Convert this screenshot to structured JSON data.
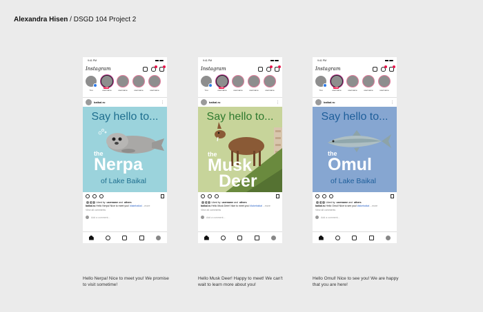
{
  "header": {
    "name": "Alexandra Hisen",
    "separator": " / ",
    "project": "DSGD 104 Project 2"
  },
  "colors": {
    "instagram_badge": "#e8174c",
    "story_ring": "#e07a9a",
    "hashtag": "#2a63c7"
  },
  "phones": [
    {
      "status": {
        "time": "9:41 PM"
      },
      "app": {
        "logo": "Instagram"
      },
      "stories": [
        {
          "label": "You"
        },
        {
          "label": "username",
          "live": "LIVE"
        },
        {
          "label": "username"
        },
        {
          "label": "username"
        },
        {
          "label": "username"
        }
      ],
      "post": {
        "username": "baikal.ru",
        "more": "⋮",
        "image": {
          "title": "Say hello to...",
          "the": "the",
          "name_line1": "Nerpa",
          "name_line2": "",
          "subtitle": "of Lake Baikal"
        },
        "liked": {
          "prefix": "Liked by",
          "user": "username",
          "and": "and",
          "others": "others"
        },
        "caption": {
          "user": "baikal.ru",
          "text": " Hello Nerpa! Nice to meet you! ",
          "tag": "#lakebaikal",
          "more": " ...more"
        },
        "view_all": "View all comments",
        "add_comment": "Add a comment..."
      },
      "below": "Hello Nerpa! Nice to meet you! We promise to visit sometime!"
    },
    {
      "status": {
        "time": "9:41 PM"
      },
      "app": {
        "logo": "Instagram"
      },
      "stories": [
        {
          "label": "You"
        },
        {
          "label": "username",
          "live": "LIVE"
        },
        {
          "label": "username"
        },
        {
          "label": "username"
        },
        {
          "label": "username"
        }
      ],
      "post": {
        "username": "baikal.ru",
        "more": "⋮",
        "image": {
          "title": "Say hello to...",
          "the": "the",
          "name_line1": "Musk",
          "name_line2": "Deer",
          "subtitle": ""
        },
        "liked": {
          "prefix": "Liked by",
          "user": "username",
          "and": "and",
          "others": "others"
        },
        "caption": {
          "user": "baikal.ru",
          "text": " Hello Musk Deer! Nice to meet you! ",
          "tag": "#lakebaikal",
          "more": " ...more"
        },
        "view_all": "View all comments",
        "add_comment": "Add a comment..."
      },
      "below": "Hello Musk Deer! Happy to meet! We can't wait to learn more about you!"
    },
    {
      "status": {
        "time": "9:41 PM"
      },
      "app": {
        "logo": "Instagram"
      },
      "stories": [
        {
          "label": "You"
        },
        {
          "label": "username",
          "live": "LIVE"
        },
        {
          "label": "username"
        },
        {
          "label": "username"
        },
        {
          "label": "username"
        }
      ],
      "post": {
        "username": "baikal.ru",
        "more": "⋮",
        "image": {
          "title": "Say hello to...",
          "the": "the",
          "name_line1": "Omul",
          "name_line2": "",
          "subtitle": "of Lake Baikal"
        },
        "liked": {
          "prefix": "Liked by",
          "user": "username",
          "and": "and",
          "others": "others"
        },
        "caption": {
          "user": "baikal.ru",
          "text": " Hello Omul! Nice to see you! ",
          "tag": "#lakebaikal",
          "more": " ...more"
        },
        "view_all": "View all comments",
        "add_comment": "Add a comment..."
      },
      "below": "Hello Omul! Nice to see you! We are happy that you are here!"
    }
  ]
}
